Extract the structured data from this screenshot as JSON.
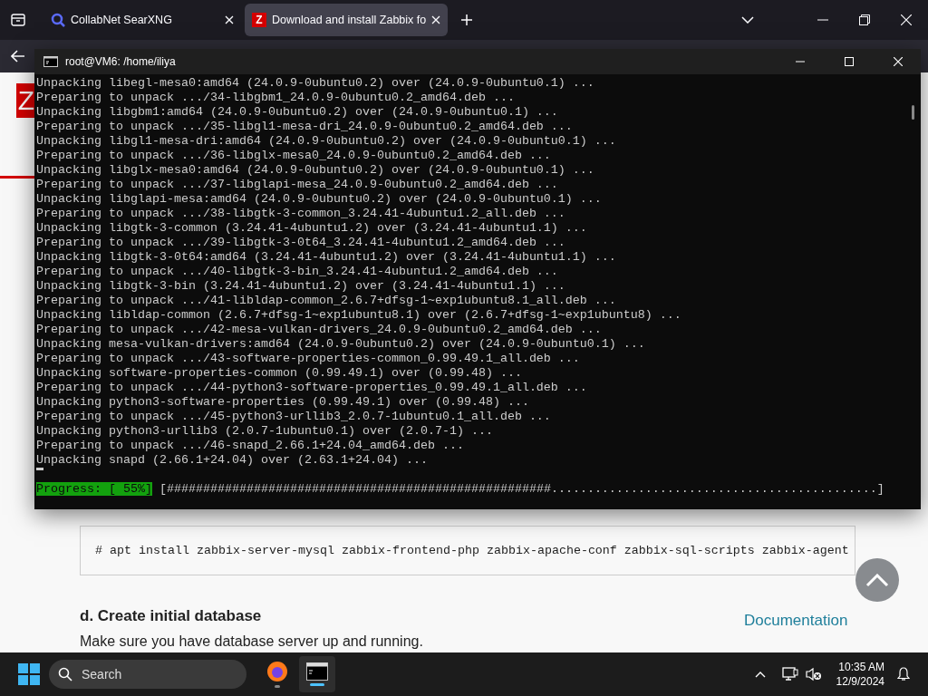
{
  "browser": {
    "tabs": [
      {
        "kind": "search",
        "title": "CollabNet SearXNG",
        "selected": false
      },
      {
        "kind": "letter",
        "icon_text": "Z",
        "title": "Download and install Zabbix fo",
        "selected": true
      }
    ]
  },
  "terminal": {
    "title": "root@VM6: /home/iliya",
    "lines": [
      "Unpacking libegl-mesa0:amd64 (24.0.9-0ubuntu0.2) over (24.0.9-0ubuntu0.1) ...",
      "Preparing to unpack .../34-libgbm1_24.0.9-0ubuntu0.2_amd64.deb ...",
      "Unpacking libgbm1:amd64 (24.0.9-0ubuntu0.2) over (24.0.9-0ubuntu0.1) ...",
      "Preparing to unpack .../35-libgl1-mesa-dri_24.0.9-0ubuntu0.2_amd64.deb ...",
      "Unpacking libgl1-mesa-dri:amd64 (24.0.9-0ubuntu0.2) over (24.0.9-0ubuntu0.1) ...",
      "Preparing to unpack .../36-libglx-mesa0_24.0.9-0ubuntu0.2_amd64.deb ...",
      "Unpacking libglx-mesa0:amd64 (24.0.9-0ubuntu0.2) over (24.0.9-0ubuntu0.1) ...",
      "Preparing to unpack .../37-libglapi-mesa_24.0.9-0ubuntu0.2_amd64.deb ...",
      "Unpacking libglapi-mesa:amd64 (24.0.9-0ubuntu0.2) over (24.0.9-0ubuntu0.1) ...",
      "Preparing to unpack .../38-libgtk-3-common_3.24.41-4ubuntu1.2_all.deb ...",
      "Unpacking libgtk-3-common (3.24.41-4ubuntu1.2) over (3.24.41-4ubuntu1.1) ...",
      "Preparing to unpack .../39-libgtk-3-0t64_3.24.41-4ubuntu1.2_amd64.deb ...",
      "Unpacking libgtk-3-0t64:amd64 (3.24.41-4ubuntu1.2) over (3.24.41-4ubuntu1.1) ...",
      "Preparing to unpack .../40-libgtk-3-bin_3.24.41-4ubuntu1.2_amd64.deb ...",
      "Unpacking libgtk-3-bin (3.24.41-4ubuntu1.2) over (3.24.41-4ubuntu1.1) ...",
      "Preparing to unpack .../41-libldap-common_2.6.7+dfsg-1~exp1ubuntu8.1_all.deb ...",
      "Unpacking libldap-common (2.6.7+dfsg-1~exp1ubuntu8.1) over (2.6.7+dfsg-1~exp1ubuntu8) ...",
      "Preparing to unpack .../42-mesa-vulkan-drivers_24.0.9-0ubuntu0.2_amd64.deb ...",
      "Unpacking mesa-vulkan-drivers:amd64 (24.0.9-0ubuntu0.2) over (24.0.9-0ubuntu0.1) ...",
      "Preparing to unpack .../43-software-properties-common_0.99.49.1_all.deb ...",
      "Unpacking software-properties-common (0.99.49.1) over (0.99.48) ...",
      "Preparing to unpack .../44-python3-software-properties_0.99.49.1_all.deb ...",
      "Unpacking python3-software-properties (0.99.49.1) over (0.99.48) ...",
      "Preparing to unpack .../45-python3-urllib3_2.0.7-1ubuntu0.1_all.deb ...",
      "Unpacking python3-urllib3 (2.0.7-1ubuntu0.1) over (2.0.7-1) ...",
      "Preparing to unpack .../46-snapd_2.66.1+24.04_amd64.deb ...",
      "Unpacking snapd (2.66.1+24.04) over (2.63.1+24.04) ..."
    ],
    "progress_label": "Progress: [ 55%]",
    "progress_bar": "[#####################################################.............................................]"
  },
  "page": {
    "logo_text": "Z",
    "code": "# apt install zabbix-server-mysql zabbix-frontend-php zabbix-apache-conf zabbix-sql-scripts zabbix-agent",
    "heading": "d. Create initial database",
    "link": "Documentation",
    "text": "Make sure you have database server up and running."
  },
  "taskbar": {
    "search_label": "Search",
    "apps": [
      {
        "kind": "browser",
        "selected": false
      },
      {
        "kind": "terminal",
        "selected": true
      }
    ],
    "time": "10:35 AM",
    "date": "12/9/2024"
  }
}
